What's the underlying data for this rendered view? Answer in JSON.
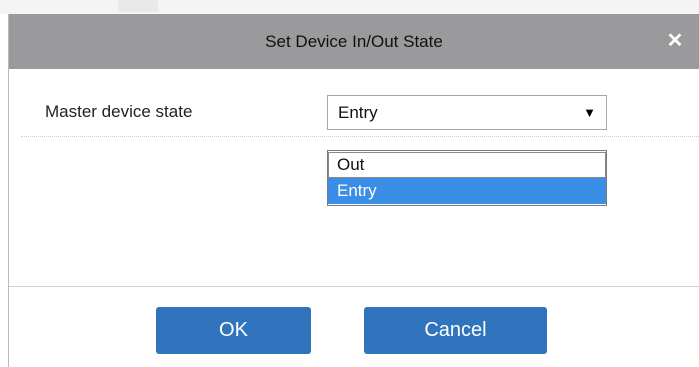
{
  "dialog": {
    "title": "Set Device In/Out State",
    "close_icon": "close-icon",
    "close_symbol": "✕"
  },
  "form": {
    "master_state_label": "Master device state",
    "master_state_value": "Entry",
    "dropdown_arrow": "▼",
    "options": [
      "Out",
      "Entry"
    ],
    "highlighted_option": "Entry"
  },
  "buttons": {
    "ok_label": "OK",
    "cancel_label": "Cancel"
  },
  "colors": {
    "titlebar": "#9a9a9c",
    "button": "#2f74bd",
    "option_highlight": "#3a8ee6"
  }
}
